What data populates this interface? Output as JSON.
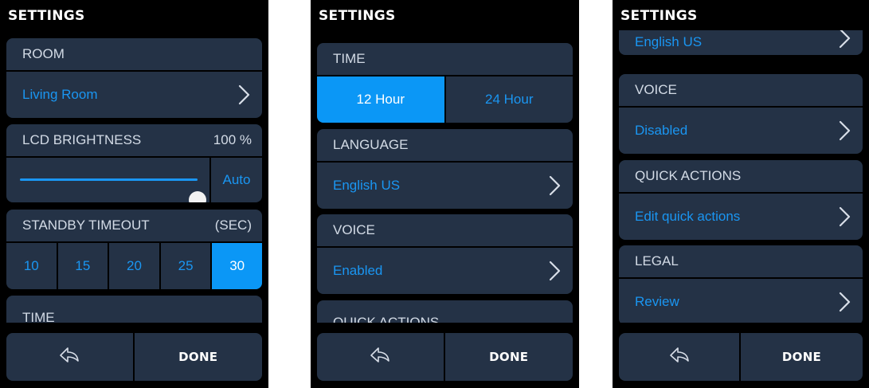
{
  "colors": {
    "background": "#000000",
    "card": "#243246",
    "accent": "#0b97f6",
    "link_text": "#1a96f2",
    "header_text": "#d3dbe6"
  },
  "screens": [
    {
      "title": "SETTINGS",
      "room": {
        "header": "ROOM",
        "value": "Living Room",
        "icon": "chevron-right-icon"
      },
      "brightness": {
        "header": "LCD BRIGHTNESS",
        "value_label": "100 %",
        "level_percent": 100,
        "auto_label": "Auto"
      },
      "standby": {
        "header": "STANDBY TIMEOUT",
        "unit": "(SEC)",
        "options": [
          "10",
          "15",
          "20",
          "25",
          "30"
        ],
        "selected": "30"
      },
      "time": {
        "header": "TIME"
      },
      "bottom": {
        "back_icon": "back-arrow-icon",
        "done_label": "DONE"
      }
    },
    {
      "title": "SETTINGS",
      "time": {
        "header": "TIME",
        "options": [
          "12 Hour",
          "24 Hour"
        ],
        "selected": "12 Hour"
      },
      "language": {
        "header": "LANGUAGE",
        "value": "English US",
        "icon": "chevron-right-icon"
      },
      "voice": {
        "header": "VOICE",
        "value": "Enabled",
        "icon": "chevron-right-icon"
      },
      "quick_actions": {
        "header": "QUICK ACTIONS"
      },
      "bottom": {
        "back_icon": "back-arrow-icon",
        "done_label": "DONE"
      }
    },
    {
      "title": "SETTINGS",
      "language": {
        "value": "English US",
        "icon": "chevron-right-icon"
      },
      "voice": {
        "header": "VOICE",
        "value": "Disabled",
        "icon": "chevron-right-icon"
      },
      "quick_actions": {
        "header": "QUICK ACTIONS",
        "value": "Edit quick actions",
        "icon": "chevron-right-icon"
      },
      "legal": {
        "header": "LEGAL",
        "value": "Review",
        "icon": "chevron-right-icon"
      },
      "bottom": {
        "back_icon": "back-arrow-icon",
        "done_label": "DONE"
      }
    }
  ]
}
